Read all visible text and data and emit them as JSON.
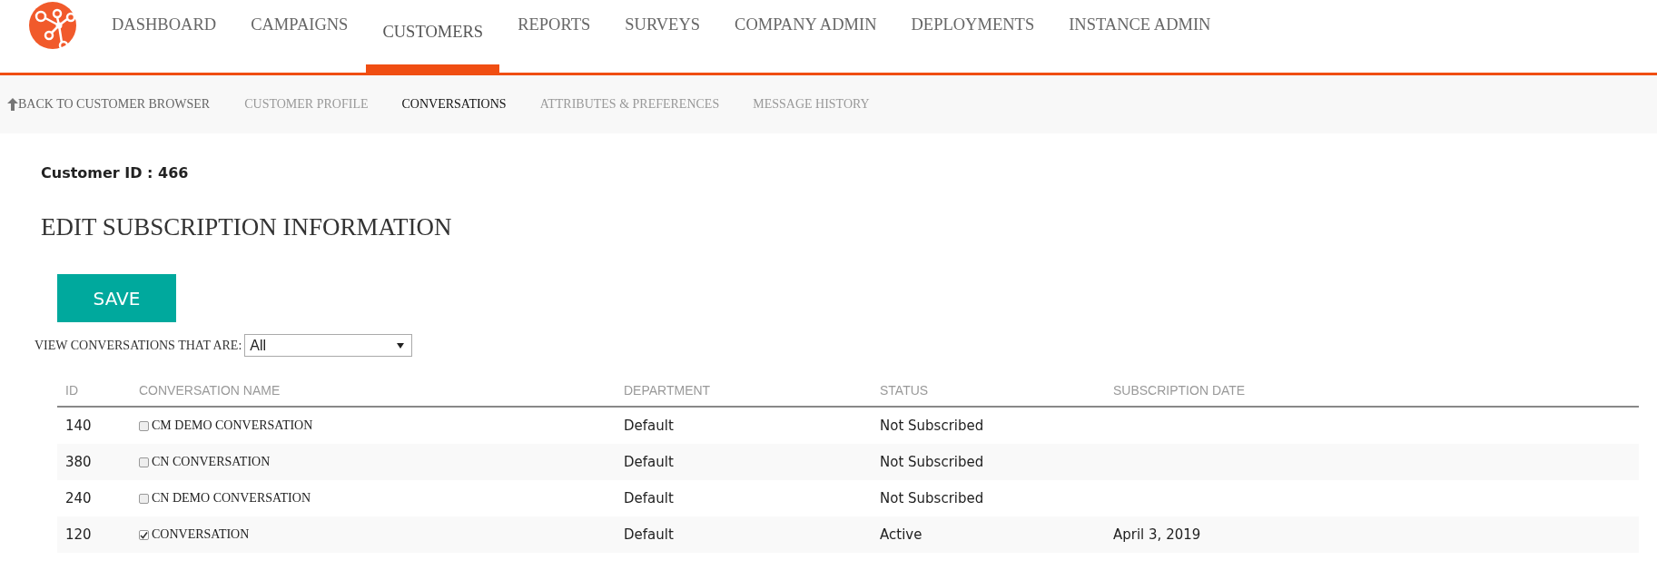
{
  "nav": {
    "items": [
      {
        "label": "DASHBOARD",
        "selected": false
      },
      {
        "label": "CAMPAIGNS",
        "selected": false
      },
      {
        "label": "CUSTOMERS",
        "selected": true
      },
      {
        "label": "REPORTS",
        "selected": false
      },
      {
        "label": "SURVEYS",
        "selected": false
      },
      {
        "label": "COMPANY ADMIN",
        "selected": false
      },
      {
        "label": "DEPLOYMENTS",
        "selected": false
      },
      {
        "label": "INSTANCE ADMIN",
        "selected": false
      }
    ]
  },
  "subnav": {
    "back": "BACK TO CUSTOMER BROWSER",
    "items": [
      {
        "label": "CUSTOMER PROFILE",
        "selected": false
      },
      {
        "label": "CONVERSATIONS",
        "selected": true
      },
      {
        "label": "ATTRIBUTES & PREFERENCES",
        "selected": false
      },
      {
        "label": "MESSAGE HISTORY",
        "selected": false
      }
    ]
  },
  "customer_id": "Customer ID : 466",
  "heading": "EDIT SUBSCRIPTION INFORMATION",
  "save_button": "SAVE",
  "filter": {
    "label": "VIEW CONVERSATIONS THAT ARE:",
    "value": "All"
  },
  "table": {
    "columns": [
      "ID",
      "CONVERSATION NAME",
      "DEPARTMENT",
      "STATUS",
      "SUBSCRIPTION DATE"
    ],
    "rows": [
      {
        "id": "140",
        "name": "CM DEMO CONVERSATION",
        "checked": false,
        "department": "Default",
        "status": "Not Subscribed",
        "date": ""
      },
      {
        "id": "380",
        "name": "CN CONVERSATION",
        "checked": false,
        "department": "Default",
        "status": "Not Subscribed",
        "date": ""
      },
      {
        "id": "240",
        "name": "CN DEMO CONVERSATION",
        "checked": false,
        "department": "Default",
        "status": "Not Subscribed",
        "date": ""
      },
      {
        "id": "120",
        "name": "CONVERSATION",
        "checked": true,
        "department": "Default",
        "status": "Active",
        "date": "April 3, 2019"
      }
    ]
  }
}
